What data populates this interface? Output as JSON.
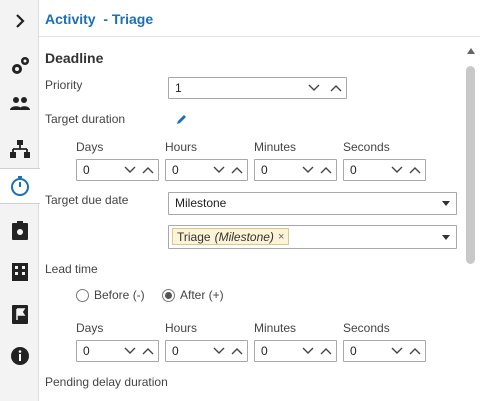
{
  "header": {
    "title": "Activity  - Triage"
  },
  "section": {
    "title": "Deadline"
  },
  "priority": {
    "label": "Priority",
    "value": "1"
  },
  "target_duration": {
    "label": "Target duration",
    "columns": [
      {
        "label": "Days",
        "value": "0"
      },
      {
        "label": "Hours",
        "value": "0"
      },
      {
        "label": "Minutes",
        "value": "0"
      },
      {
        "label": "Seconds",
        "value": "0"
      }
    ]
  },
  "target_due_date": {
    "label": "Target due date",
    "selected": "Milestone",
    "tag_name": "Triage",
    "tag_detail": "(Milestone)",
    "tag_remove": "×"
  },
  "lead_time": {
    "label": "Lead time",
    "before_label": "Before (-)",
    "after_label": "After (+)",
    "selected": "after",
    "columns": [
      {
        "label": "Days",
        "value": "0"
      },
      {
        "label": "Hours",
        "value": "0"
      },
      {
        "label": "Minutes",
        "value": "0"
      },
      {
        "label": "Seconds",
        "value": "0"
      }
    ]
  },
  "pending_delay": {
    "label": "Pending delay duration"
  },
  "rail": {
    "icons": [
      "chevron-right-icon",
      "gears-icon",
      "people-icon",
      "org-chart-icon",
      "stopwatch-icon",
      "clipboard-gear-icon",
      "building-icon",
      "flag-doc-icon",
      "info-icon"
    ],
    "active": "stopwatch-icon"
  },
  "colors": {
    "accent": "#1a6fb5",
    "tag_bg": "#fcf4d6"
  }
}
